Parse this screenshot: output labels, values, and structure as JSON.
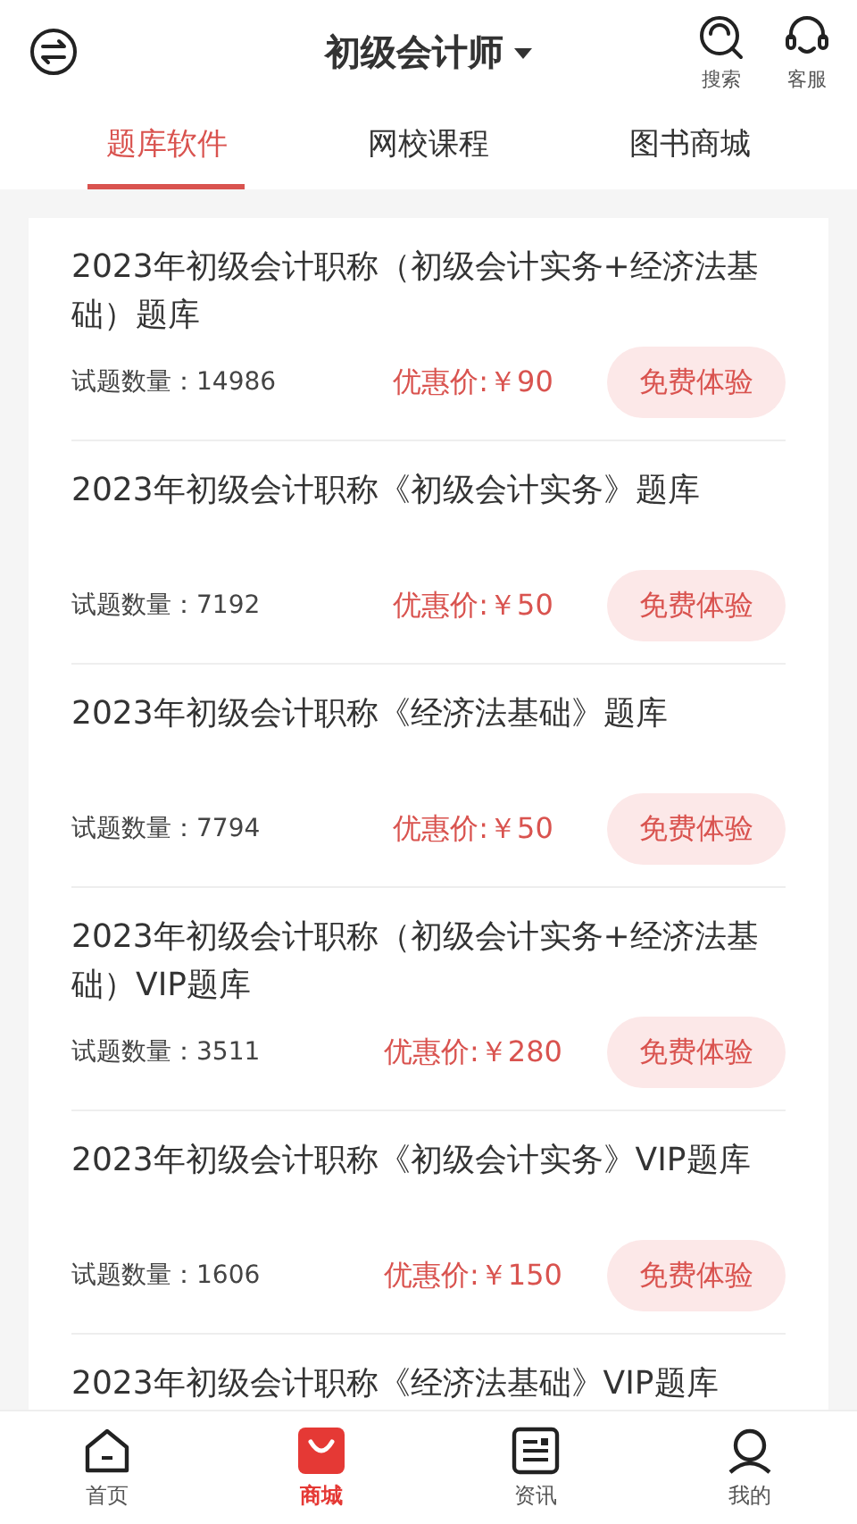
{
  "header": {
    "title": "初级会计师",
    "actions": [
      {
        "label": "搜索",
        "kind": "search"
      },
      {
        "label": "客服",
        "kind": "support"
      }
    ]
  },
  "tabs": [
    {
      "label": "题库软件",
      "selected": true
    },
    {
      "label": "网校课程",
      "selected": false
    },
    {
      "label": "图书商城",
      "selected": false
    }
  ],
  "products": [
    {
      "title": "2023年初级会计职称（初级会计实务+经济法基础）题库",
      "count": "试题数量：14986",
      "price": "优惠价:￥90",
      "button": "免费体验"
    },
    {
      "title": "2023年初级会计职称《初级会计实务》题库",
      "count": "试题数量：7192",
      "price": "优惠价:￥50",
      "button": "免费体验"
    },
    {
      "title": "2023年初级会计职称《经济法基础》题库",
      "count": "试题数量：7794",
      "price": "优惠价:￥50",
      "button": "免费体验"
    },
    {
      "title": "2023年初级会计职称（初级会计实务+经济法基础）VIP题库",
      "count": "试题数量：3511",
      "price": "优惠价:￥280",
      "button": "免费体验"
    },
    {
      "title": "2023年初级会计职称《初级会计实务》VIP题库",
      "count": "试题数量：1606",
      "price": "优惠价:￥150",
      "button": "免费体验"
    },
    {
      "title": "2023年初级会计职称《经济法基础》VIP题库"
    }
  ],
  "bottom_nav": [
    {
      "label": "首页",
      "kind": "home",
      "selected": false
    },
    {
      "label": "商城",
      "kind": "shop",
      "selected": true
    },
    {
      "label": "资讯",
      "kind": "news",
      "selected": false
    },
    {
      "label": "我的",
      "kind": "profile",
      "selected": false
    }
  ]
}
